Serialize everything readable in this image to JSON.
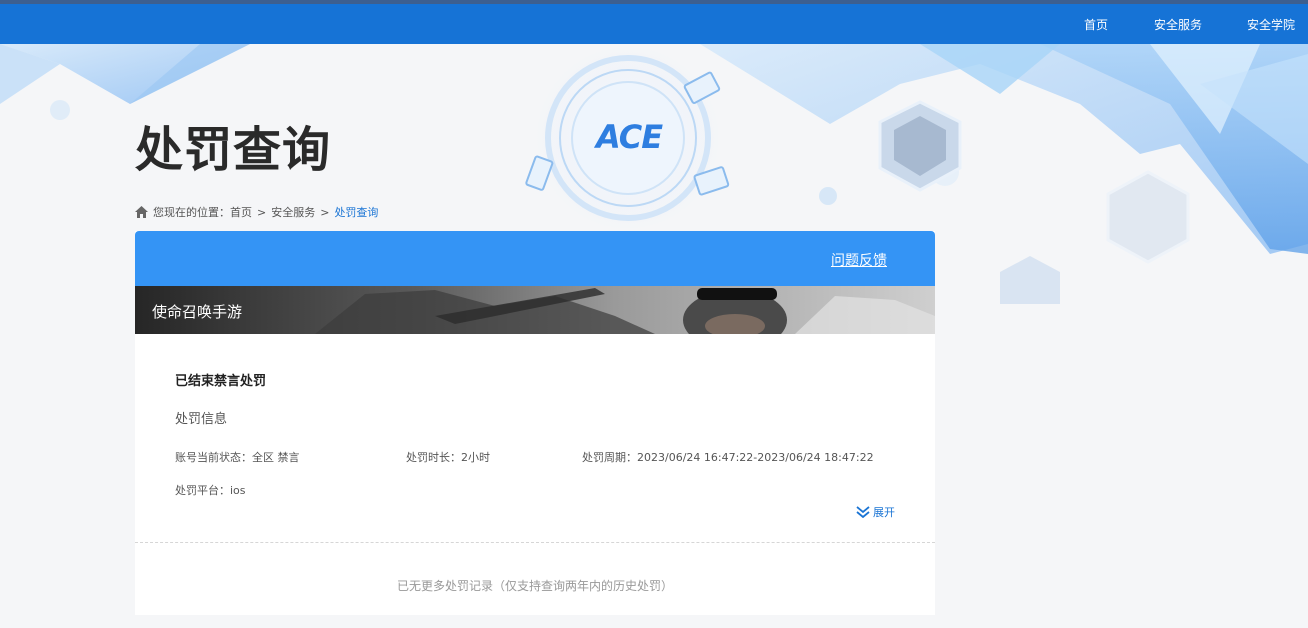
{
  "topnav": {
    "items": [
      "首页",
      "安全服务",
      "安全学院"
    ]
  },
  "page_title": "处罚查询",
  "breadcrumb": {
    "prefix": "您现在的位置：",
    "items": [
      "首页",
      "安全服务",
      "处罚查询"
    ],
    "separator": ">"
  },
  "logo_text": "ACE",
  "feedback_label": "问题反馈",
  "game_name": "使命召唤手游",
  "record": {
    "status_title": "已结束禁言处罚",
    "info_heading": "处罚信息",
    "account_status": "账号当前状态：全区 禁言",
    "duration": "处罚时长：2小时",
    "period": "处罚周期：2023/06/24 16:47:22-2023/06/24 18:47:22",
    "platform": "处罚平台：ios",
    "expand_label": "展开"
  },
  "end_note": "已无更多处罚记录（仅支持查询两年内的历史处罚）",
  "colors": {
    "topbar": "#1673d6",
    "panel_header": "#3494f5",
    "link_blue": "#1a74d4"
  }
}
